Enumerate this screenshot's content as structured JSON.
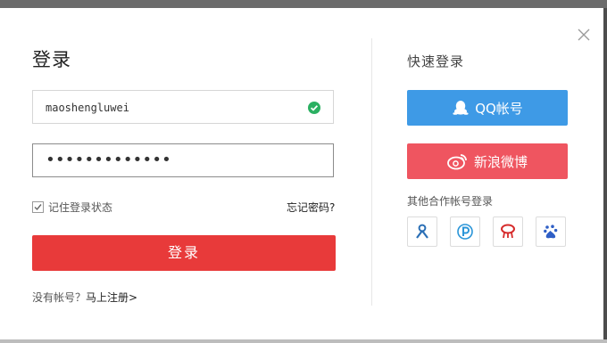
{
  "dialog": {
    "title": "登录",
    "close_icon": "close-icon"
  },
  "form": {
    "username_value": "maoshengluwei",
    "username_status_icon": "check-circle-icon",
    "password_mask": "•••••••••••••",
    "remember_checked": true,
    "remember_label": "记住登录状态",
    "forgot_label": "忘记密码?",
    "submit_label": "登录",
    "register_prefix": "没有帐号？",
    "register_link": "马上注册>"
  },
  "quick_login": {
    "title": "快速登录",
    "qq_label": "QQ帐号",
    "weibo_label": "新浪微博",
    "other_title": "其他合作帐号登录",
    "other_icons": [
      "renren-icon",
      "paipai-icon",
      "red-scarf-icon",
      "baidu-icon"
    ]
  },
  "colors": {
    "login_button": "#e83a3a",
    "qq_button": "#3e9ae6",
    "weibo_button": "#ef5560",
    "check_green": "#2bb062"
  }
}
